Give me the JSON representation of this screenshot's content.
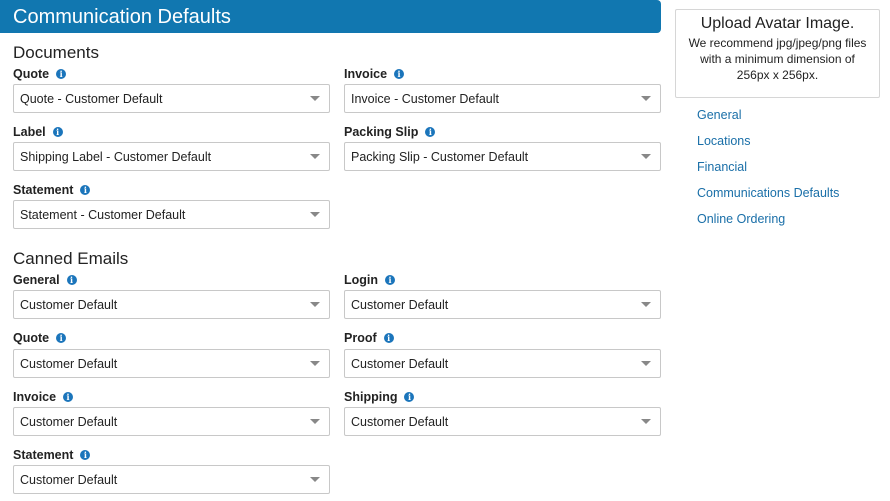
{
  "header": {
    "title": "Communication Defaults"
  },
  "documents": {
    "title": "Documents",
    "fields": [
      {
        "label": "Quote",
        "value": "Quote - Customer Default"
      },
      {
        "label": "Invoice",
        "value": "Invoice - Customer Default"
      },
      {
        "label": "Label",
        "value": "Shipping Label - Customer Default"
      },
      {
        "label": "Packing Slip",
        "value": "Packing Slip - Customer Default"
      },
      {
        "label": "Statement",
        "value": "Statement - Customer Default"
      }
    ]
  },
  "canned_emails": {
    "title": "Canned Emails",
    "fields": [
      {
        "label": "General",
        "value": "Customer Default"
      },
      {
        "label": "Login",
        "value": "Customer Default"
      },
      {
        "label": "Quote",
        "value": "Customer Default"
      },
      {
        "label": "Proof",
        "value": "Customer Default"
      },
      {
        "label": "Invoice",
        "value": "Customer Default"
      },
      {
        "label": "Shipping",
        "value": "Customer Default"
      },
      {
        "label": "Statement",
        "value": "Customer Default"
      }
    ]
  },
  "avatar": {
    "title": "Upload Avatar Image.",
    "hint": "We recommend jpg/jpeg/png files with a minimum dimension of 256px x 256px."
  },
  "sidebar": {
    "links": [
      "General",
      "Locations",
      "Financial",
      "Communications Defaults",
      "Online Ordering"
    ]
  },
  "colors": {
    "header": "#1177b0",
    "link": "#1a6fa8",
    "info_icon": "#1b75bb"
  },
  "icons": {
    "info": "info-icon",
    "dropdown": "chevron-down-icon"
  }
}
